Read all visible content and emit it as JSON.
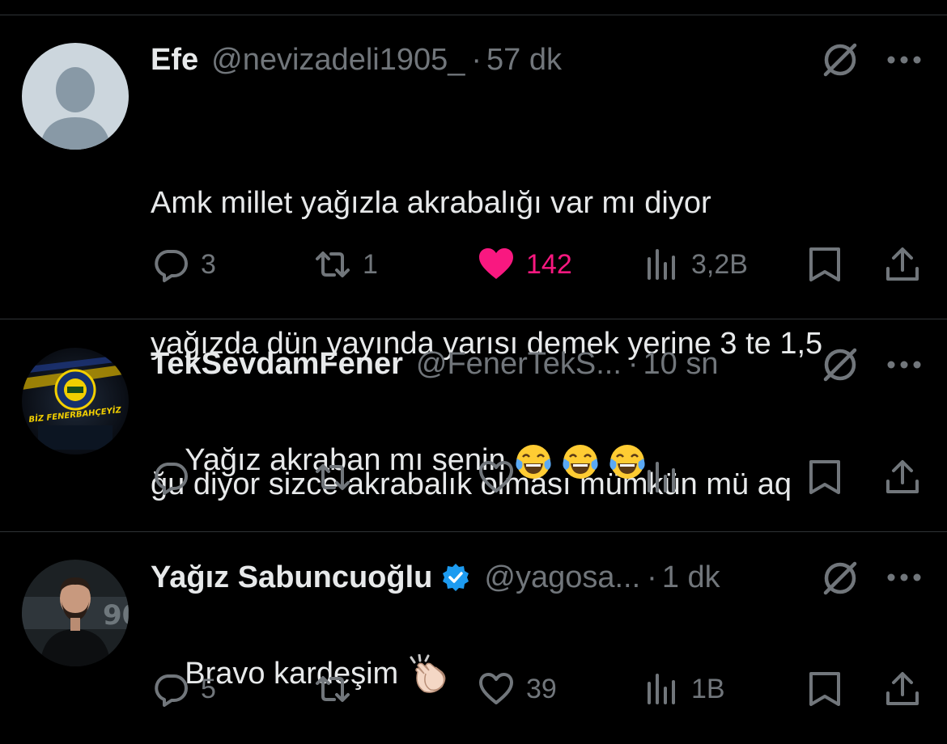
{
  "tweets": [
    {
      "display_name": "Efe",
      "handle": "@nevizadeli1905_",
      "separator": "·",
      "time": "57 dk",
      "verified": false,
      "text_lines": [
        "Amk millet yağızla akrabalığı var mı diyor",
        "yağızda dün yayında yarısı demek yerine 3 te 1,5",
        "ğu diyor sizce akrabalık olması mümkün mü aq"
      ],
      "avatar": "default-avatar",
      "counts": {
        "reply": "3",
        "retweet": "1",
        "like": "142",
        "views": "3,2B"
      },
      "liked": true
    },
    {
      "display_name": "TekSevdamFener",
      "handle": "@FenerTekS...",
      "separator": "·",
      "time": "10 sn",
      "verified": false,
      "text": "Yağız akraban mı senin",
      "emojis": [
        "face-with-tears-of-joy",
        "face-with-tears-of-joy",
        "face-with-tears-of-joy"
      ],
      "avatar": "fenerbahce-logo-avatar",
      "avatar_caption": "BİZ FENERBAHÇEYİZ",
      "counts": {
        "reply": "",
        "retweet": "",
        "like": "",
        "views": ""
      },
      "liked": false
    },
    {
      "display_name": "Yağız Sabuncuoğlu",
      "handle": "@yagosa...",
      "separator": "·",
      "time": "1 dk",
      "verified": true,
      "text": "Bravo kardeşim",
      "emojis": [
        "clapping-hands"
      ],
      "avatar": "photo-avatar",
      "counts": {
        "reply": "5",
        "retweet": "",
        "like": "39",
        "views": "1B"
      },
      "liked": false
    }
  ],
  "colors": {
    "background": "#000000",
    "text": "#e7e9ea",
    "muted": "#71767b",
    "like": "#f91880",
    "verified": "#1d9bf0",
    "divider": "#2f3336"
  },
  "icons": [
    "reply-icon",
    "retweet-icon",
    "like-icon",
    "views-icon",
    "bookmark-icon",
    "share-icon",
    "grok-icon",
    "more-icon"
  ]
}
